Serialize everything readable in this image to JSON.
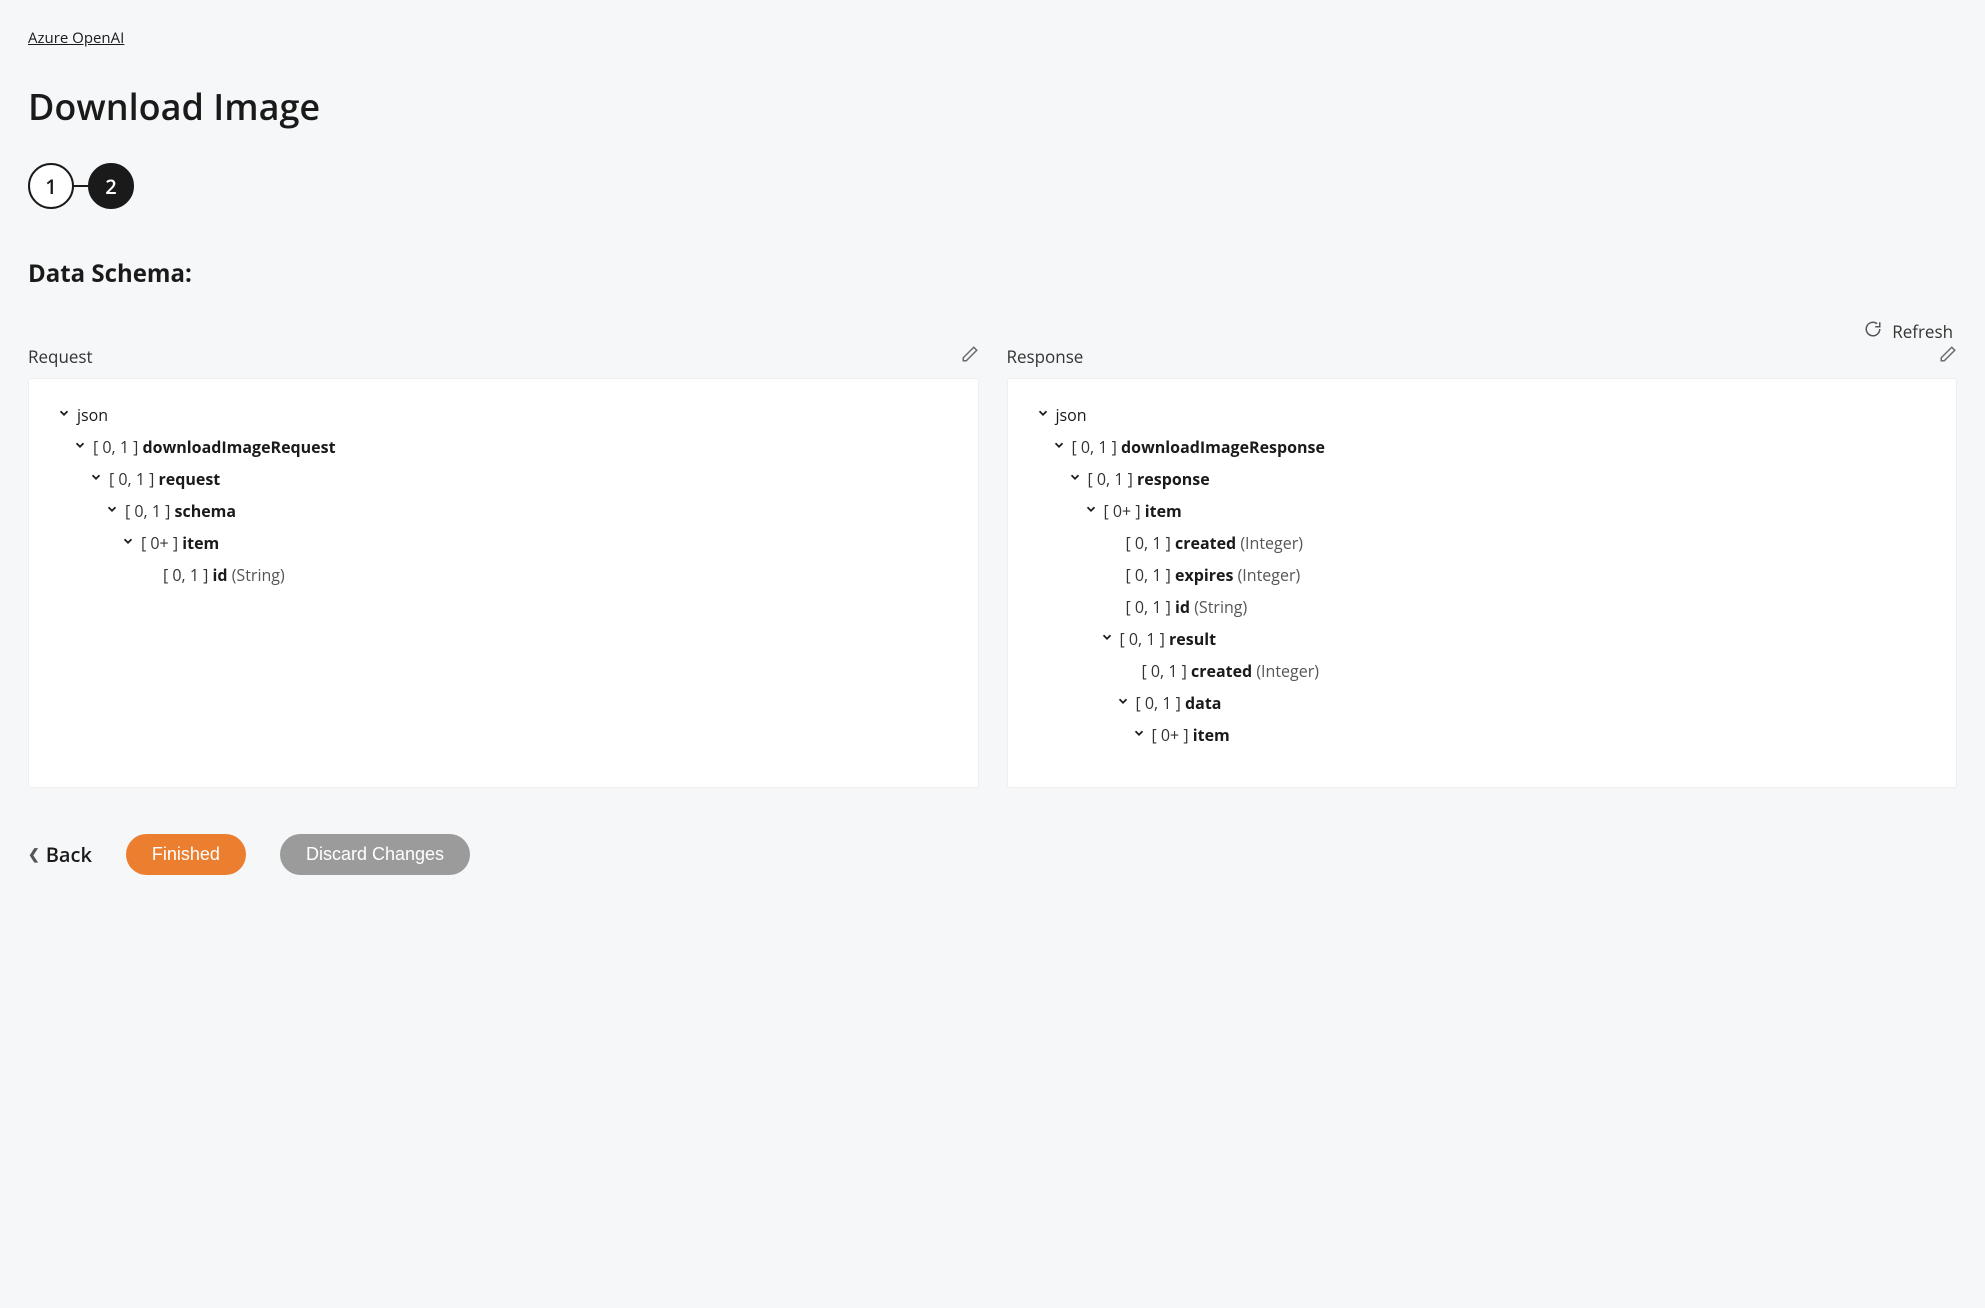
{
  "breadcrumb": "Azure OpenAI",
  "page_title": "Download Image",
  "stepper": {
    "step1": "1",
    "step2": "2"
  },
  "section_title": "Data Schema:",
  "refresh_label": "Refresh",
  "request_label": "Request",
  "response_label": "Response",
  "footer": {
    "back": "Back",
    "finished": "Finished",
    "discard": "Discard Changes"
  },
  "request_tree": [
    {
      "indent": 0,
      "chev": true,
      "card": "",
      "name": "json",
      "name_bold": false,
      "type": ""
    },
    {
      "indent": 1,
      "chev": true,
      "card": "[ 0, 1 ]",
      "name": "downloadImageRequest",
      "name_bold": true,
      "type": ""
    },
    {
      "indent": 2,
      "chev": true,
      "card": "[ 0, 1 ]",
      "name": "request",
      "name_bold": true,
      "type": ""
    },
    {
      "indent": 3,
      "chev": true,
      "card": "[ 0, 1 ]",
      "name": "schema",
      "name_bold": true,
      "type": ""
    },
    {
      "indent": 4,
      "chev": true,
      "card": "[ 0+ ]",
      "name": "item",
      "name_bold": true,
      "type": ""
    },
    {
      "indent": 5,
      "chev": false,
      "card": "[ 0, 1 ]",
      "name": "id",
      "name_bold": true,
      "type": "(String)"
    }
  ],
  "response_tree": [
    {
      "indent": 0,
      "chev": true,
      "card": "",
      "name": "json",
      "name_bold": false,
      "type": ""
    },
    {
      "indent": 1,
      "chev": true,
      "card": "[ 0, 1 ]",
      "name": "downloadImageResponse",
      "name_bold": true,
      "type": ""
    },
    {
      "indent": 2,
      "chev": true,
      "card": "[ 0, 1 ]",
      "name": "response",
      "name_bold": true,
      "type": ""
    },
    {
      "indent": 3,
      "chev": true,
      "card": "[ 0+ ]",
      "name": "item",
      "name_bold": true,
      "type": ""
    },
    {
      "indent": 4,
      "chev": false,
      "card": "[ 0, 1 ]",
      "name": "created",
      "name_bold": true,
      "type": "(Integer)"
    },
    {
      "indent": 4,
      "chev": false,
      "card": "[ 0, 1 ]",
      "name": "expires",
      "name_bold": true,
      "type": "(Integer)"
    },
    {
      "indent": 4,
      "chev": false,
      "card": "[ 0, 1 ]",
      "name": "id",
      "name_bold": true,
      "type": "(String)"
    },
    {
      "indent": 4,
      "chev": true,
      "card": "[ 0, 1 ]",
      "name": "result",
      "name_bold": true,
      "type": ""
    },
    {
      "indent": 5,
      "chev": false,
      "card": "[ 0, 1 ]",
      "name": "created",
      "name_bold": true,
      "type": "(Integer)"
    },
    {
      "indent": 5,
      "chev": true,
      "card": "[ 0, 1 ]",
      "name": "data",
      "name_bold": true,
      "type": ""
    },
    {
      "indent": 6,
      "chev": true,
      "card": "[ 0+ ]",
      "name": "item",
      "name_bold": true,
      "type": ""
    }
  ]
}
